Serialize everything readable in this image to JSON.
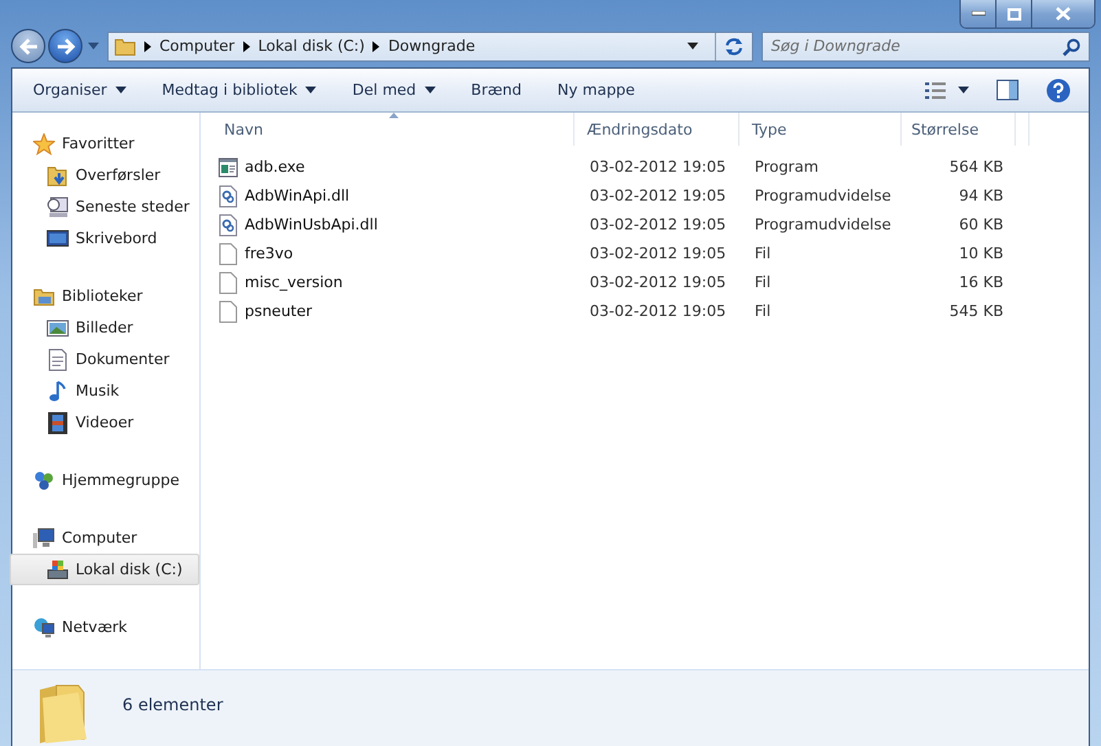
{
  "address_bar": {
    "path": [
      "Computer",
      "Lokal disk (C:)",
      "Downgrade"
    ]
  },
  "search": {
    "placeholder": "Søg i Downgrade"
  },
  "toolbar": {
    "items": [
      {
        "label": "Organiser",
        "dropdown": true
      },
      {
        "label": "Medtag i bibliotek",
        "dropdown": true
      },
      {
        "label": "Del med",
        "dropdown": true
      },
      {
        "label": "Brænd",
        "dropdown": false
      },
      {
        "label": "Ny mappe",
        "dropdown": false
      }
    ]
  },
  "sidebar": {
    "groups": [
      {
        "label": "Favoritter",
        "selected": false,
        "children": [
          {
            "label": "Overførsler",
            "selected": false
          },
          {
            "label": "Seneste steder",
            "selected": false
          },
          {
            "label": "Skrivebord",
            "selected": false
          }
        ]
      },
      {
        "label": "Biblioteker",
        "selected": false,
        "children": [
          {
            "label": "Billeder",
            "selected": false
          },
          {
            "label": "Dokumenter",
            "selected": false
          },
          {
            "label": "Musik",
            "selected": false
          },
          {
            "label": "Videoer",
            "selected": false
          }
        ]
      },
      {
        "label": "Hjemmegruppe",
        "selected": false
      },
      {
        "label": "Computer",
        "selected": false,
        "children": [
          {
            "label": "Lokal disk (C:)",
            "selected": true
          }
        ]
      },
      {
        "label": "Netværk",
        "selected": false
      }
    ]
  },
  "table": {
    "columns": [
      {
        "label": "Navn",
        "sorted": true
      },
      {
        "label": "Ændringsdato",
        "sorted": false
      },
      {
        "label": "Type",
        "sorted": false
      },
      {
        "label": "Størrelse",
        "sorted": false
      }
    ],
    "rows": [
      {
        "kind": "exe",
        "name": "adb.exe",
        "date": "03-02-2012 19:05",
        "type": "Program",
        "size": "564 KB"
      },
      {
        "kind": "dll",
        "name": "AdbWinApi.dll",
        "date": "03-02-2012 19:05",
        "type": "Programudvidelse",
        "size": "94 KB"
      },
      {
        "kind": "dll",
        "name": "AdbWinUsbApi.dll",
        "date": "03-02-2012 19:05",
        "type": "Programudvidelse",
        "size": "60 KB"
      },
      {
        "kind": "file",
        "name": "fre3vo",
        "date": "03-02-2012 19:05",
        "type": "Fil",
        "size": "10 KB"
      },
      {
        "kind": "file",
        "name": "misc_version",
        "date": "03-02-2012 19:05",
        "type": "Fil",
        "size": "16 KB"
      },
      {
        "kind": "file",
        "name": "psneuter",
        "date": "03-02-2012 19:05",
        "type": "Fil",
        "size": "545 KB"
      }
    ]
  },
  "status_bar": {
    "count": "6 elementer"
  }
}
